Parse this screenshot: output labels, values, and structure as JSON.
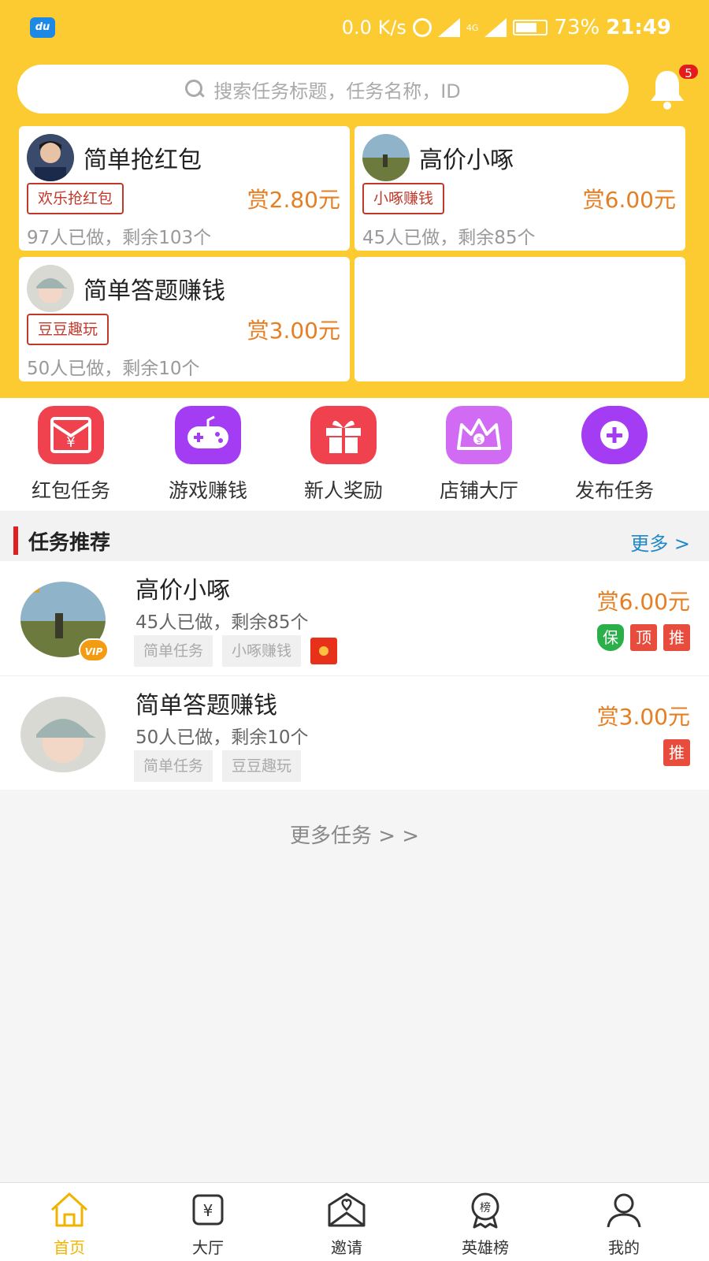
{
  "status_bar": {
    "app_badge": "du",
    "net_speed": "0.0 K/s",
    "battery": "73%",
    "battery_level": 0.73,
    "time": "21:49",
    "network": "4G"
  },
  "search": {
    "placeholder": "搜索任务标题，任务名称，ID"
  },
  "notifications": {
    "count": "5"
  },
  "top_cards": [
    {
      "title": "简单抢红包",
      "tag": "欢乐抢红包",
      "reward": "赏2.80元",
      "stat": "97人已做，剩余103个"
    },
    {
      "title": "高价小啄",
      "tag": "小啄赚钱",
      "reward": "赏6.00元",
      "stat": "45人已做，剩余85个"
    },
    {
      "title": "简单答题赚钱",
      "tag": "豆豆趣玩",
      "reward": "赏3.00元",
      "stat": "50人已做，剩余10个"
    }
  ],
  "quick_nav": [
    {
      "label": "红包任务",
      "icon": "red-envelope-icon",
      "color": "#f0414e"
    },
    {
      "label": "游戏赚钱",
      "icon": "gamepad-icon",
      "color": "#a33cf2"
    },
    {
      "label": "新人奖励",
      "icon": "gift-icon",
      "color": "#f0414e"
    },
    {
      "label": "店铺大厅",
      "icon": "crown-icon",
      "color": "#d26bf4"
    },
    {
      "label": "发布任务",
      "icon": "plus-icon",
      "color": "#a33cf2"
    }
  ],
  "section": {
    "title": "任务推荐",
    "more": "更多 >"
  },
  "task_list": [
    {
      "title": "高价小啄",
      "stat": "45人已做，剩余85个",
      "tags": [
        "简单任务",
        "小啄赚钱"
      ],
      "reward": "赏6.00元",
      "vip": "VIP",
      "badges": [
        "保",
        "顶",
        "推"
      ]
    },
    {
      "title": "简单答题赚钱",
      "stat": "50人已做，剩余10个",
      "tags": [
        "简单任务",
        "豆豆趣玩"
      ],
      "reward": "赏3.00元",
      "badges": [
        "推"
      ]
    }
  ],
  "more_tasks": "更多任务 > >",
  "tab_bar": [
    {
      "label": "首页",
      "icon": "home-icon",
      "active": true
    },
    {
      "label": "大厅",
      "icon": "yuan-icon"
    },
    {
      "label": "邀请",
      "icon": "envelope-heart-icon"
    },
    {
      "label": "英雄榜",
      "icon": "ranking-badge-icon"
    },
    {
      "label": "我的",
      "icon": "user-icon"
    }
  ],
  "colors": {
    "accent_yellow": "#fccb32",
    "reward_orange": "#e67e22",
    "tag_red": "#c0392b",
    "link_blue": "#1e88c8"
  }
}
